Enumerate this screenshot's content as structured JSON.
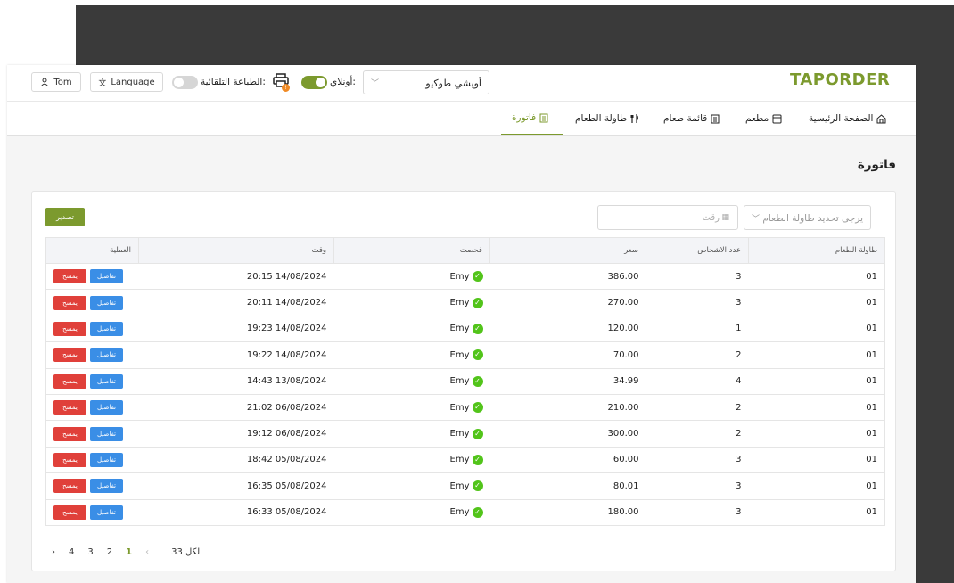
{
  "header": {
    "logo": "TAPORDER",
    "store_select_value": "أويشي طوكيو",
    "online_label": "أونلاي:",
    "auto_print_label": "الطباعة التلقائية:",
    "printer_badge": "!",
    "language_label": "Language",
    "user_label": "Tom"
  },
  "nav": {
    "items": [
      {
        "label": "الصفحة الرئيسية",
        "icon": "home-icon"
      },
      {
        "label": "مطعم",
        "icon": "store-icon"
      },
      {
        "label": "قائمة طعام",
        "icon": "menu-icon"
      },
      {
        "label": "طاولة الطعام",
        "icon": "cutlery-icon"
      },
      {
        "label": "فاتورة",
        "icon": "invoice-icon"
      }
    ],
    "active": "فاتورة"
  },
  "page": {
    "title": "فاتورة",
    "table_select_placeholder": "يرجى تحديد طاولة الطعام",
    "date_placeholder": "رقت",
    "export_label": "تصدير"
  },
  "table": {
    "headers": [
      "طاولة الطعام",
      "عدد الاشخاص",
      "سعر",
      "فحصت",
      "وقت",
      "العملية"
    ],
    "rows": [
      {
        "table": "01",
        "people": "3",
        "price": "386.00",
        "checked": "Emy",
        "time": "20:15 14/08/2024"
      },
      {
        "table": "01",
        "people": "3",
        "price": "270.00",
        "checked": "Emy",
        "time": "20:11 14/08/2024"
      },
      {
        "table": "01",
        "people": "1",
        "price": "120.00",
        "checked": "Emy",
        "time": "19:23 14/08/2024"
      },
      {
        "table": "01",
        "people": "2",
        "price": "70.00",
        "checked": "Emy",
        "time": "19:22 14/08/2024"
      },
      {
        "table": "01",
        "people": "4",
        "price": "34.99",
        "checked": "Emy",
        "time": "14:43 13/08/2024"
      },
      {
        "table": "01",
        "people": "2",
        "price": "210.00",
        "checked": "Emy",
        "time": "21:02 06/08/2024"
      },
      {
        "table": "01",
        "people": "2",
        "price": "300.00",
        "checked": "Emy",
        "time": "19:12 06/08/2024"
      },
      {
        "table": "01",
        "people": "3",
        "price": "60.00",
        "checked": "Emy",
        "time": "18:42 05/08/2024"
      },
      {
        "table": "01",
        "people": "3",
        "price": "80.01",
        "checked": "Emy",
        "time": "16:35 05/08/2024"
      },
      {
        "table": "01",
        "people": "3",
        "price": "180.00",
        "checked": "Emy",
        "time": "16:33 05/08/2024"
      }
    ],
    "detail_label": "تفاصيل",
    "delete_label": "يمسح"
  },
  "pagination": {
    "total_label": "الكل 33",
    "pages": [
      "1",
      "2",
      "3",
      "4"
    ],
    "current": "1",
    "prev": "‹",
    "next": "›"
  },
  "colors": {
    "brand": "#7c9a2e",
    "detail_button": "#3a8ee6",
    "delete_button": "#e0403a",
    "check": "#52c41a"
  }
}
